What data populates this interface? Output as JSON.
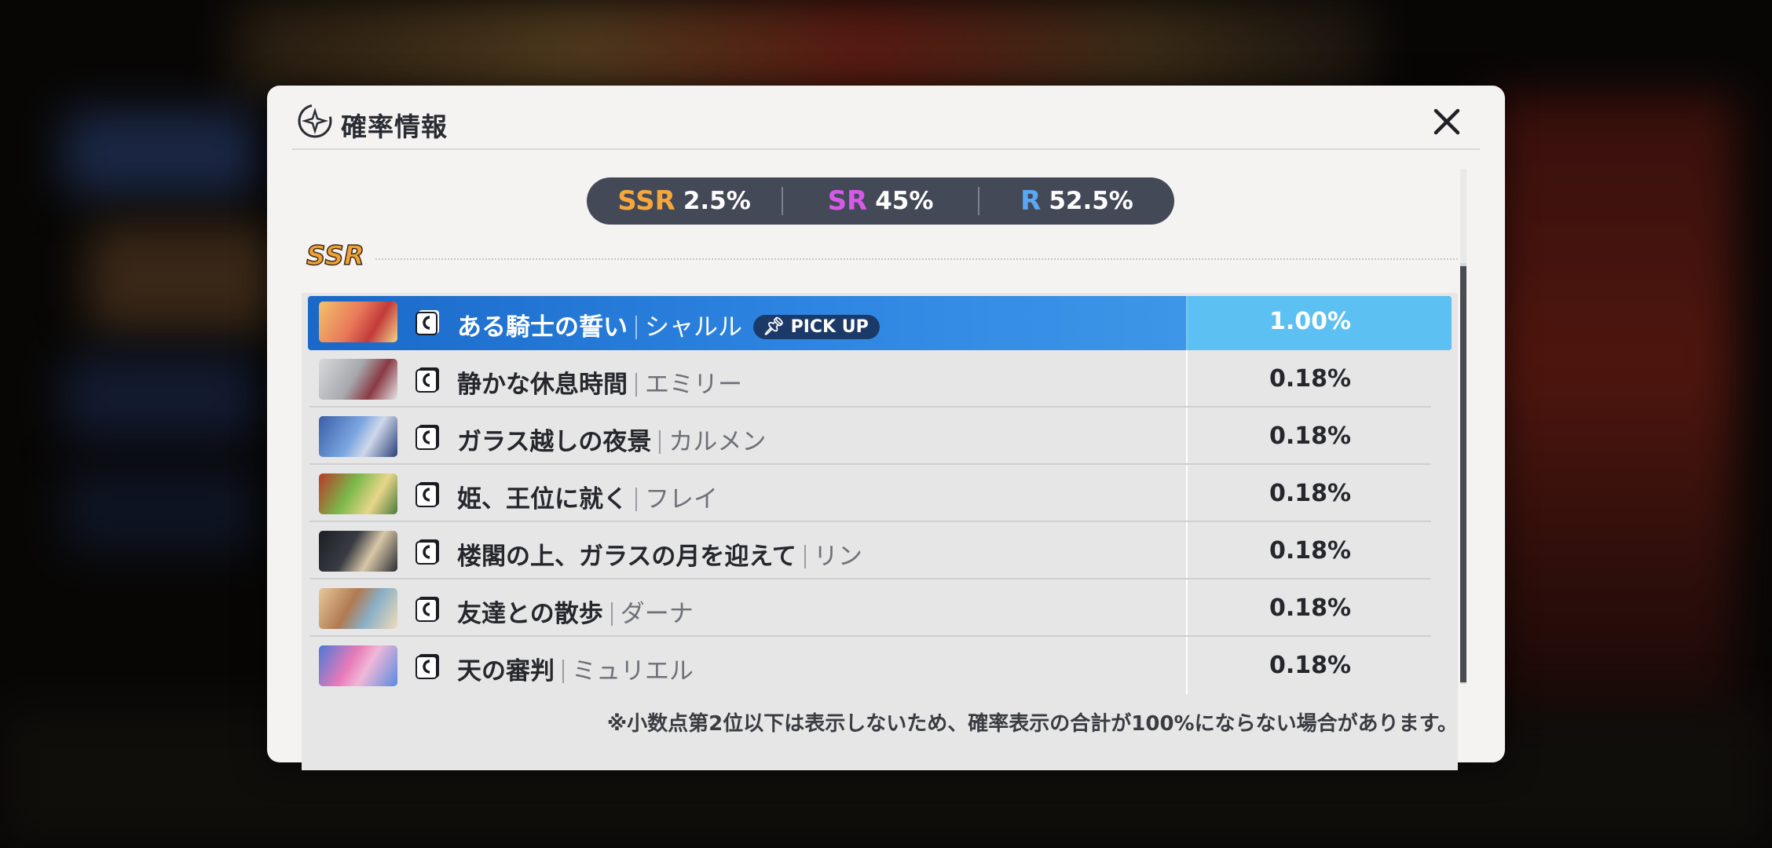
{
  "modal": {
    "title": "確率情報",
    "rates": [
      {
        "rank": "SSR",
        "value": "2.5%",
        "color": "#f5a73b"
      },
      {
        "rank": "SR",
        "value": "45%",
        "color": "#d65ae8"
      },
      {
        "rank": "R",
        "value": "52.5%",
        "color": "#5aa8f5"
      }
    ],
    "section": "SSR",
    "rows": [
      {
        "card": "ある騎士の誓い",
        "character": "シャルル",
        "badge": "PICK UP",
        "prob": "1.00%",
        "highlight": true
      },
      {
        "card": "静かな休息時間",
        "character": "エミリー",
        "prob": "0.18%"
      },
      {
        "card": "ガラス越しの夜景",
        "character": "カルメン",
        "prob": "0.18%"
      },
      {
        "card": "姫、王位に就く",
        "character": "フレイ",
        "prob": "0.18%"
      },
      {
        "card": "楼閣の上、ガラスの月を迎えて",
        "character": "リン",
        "prob": "0.18%"
      },
      {
        "card": "友達との散歩",
        "character": "ダーナ",
        "prob": "0.18%"
      },
      {
        "card": "天の審判",
        "character": "ミュリエル",
        "prob": "0.18%"
      }
    ],
    "footnote": "※小数点第2位以下は表示しないため、確率表示の合計が100%にならない場合があります。"
  },
  "colors": {
    "highlight": "#2e86e2",
    "pill": "#444957"
  },
  "icons": {
    "logo": "compass-star-icon",
    "close": "close-icon",
    "card_type": "card-type-icon",
    "pin": "pin-icon"
  }
}
